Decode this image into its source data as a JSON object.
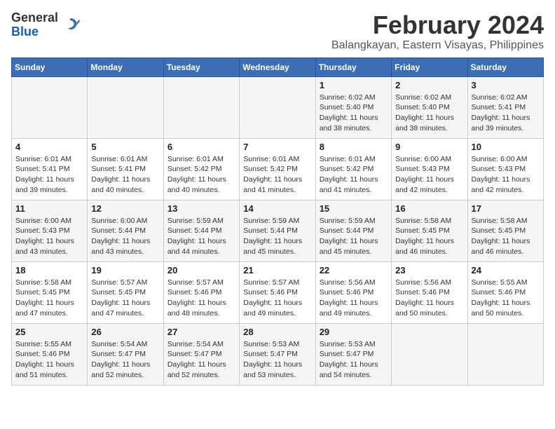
{
  "header": {
    "logo_general": "General",
    "logo_blue": "Blue",
    "month_title": "February 2024",
    "location": "Balangkayan, Eastern Visayas, Philippines"
  },
  "weekdays": [
    "Sunday",
    "Monday",
    "Tuesday",
    "Wednesday",
    "Thursday",
    "Friday",
    "Saturday"
  ],
  "weeks": [
    [
      {
        "day": "",
        "info": ""
      },
      {
        "day": "",
        "info": ""
      },
      {
        "day": "",
        "info": ""
      },
      {
        "day": "",
        "info": ""
      },
      {
        "day": "1",
        "info": "Sunrise: 6:02 AM\nSunset: 5:40 PM\nDaylight: 11 hours\nand 38 minutes."
      },
      {
        "day": "2",
        "info": "Sunrise: 6:02 AM\nSunset: 5:40 PM\nDaylight: 11 hours\nand 38 minutes."
      },
      {
        "day": "3",
        "info": "Sunrise: 6:02 AM\nSunset: 5:41 PM\nDaylight: 11 hours\nand 39 minutes."
      }
    ],
    [
      {
        "day": "4",
        "info": "Sunrise: 6:01 AM\nSunset: 5:41 PM\nDaylight: 11 hours\nand 39 minutes."
      },
      {
        "day": "5",
        "info": "Sunrise: 6:01 AM\nSunset: 5:41 PM\nDaylight: 11 hours\nand 40 minutes."
      },
      {
        "day": "6",
        "info": "Sunrise: 6:01 AM\nSunset: 5:42 PM\nDaylight: 11 hours\nand 40 minutes."
      },
      {
        "day": "7",
        "info": "Sunrise: 6:01 AM\nSunset: 5:42 PM\nDaylight: 11 hours\nand 41 minutes."
      },
      {
        "day": "8",
        "info": "Sunrise: 6:01 AM\nSunset: 5:42 PM\nDaylight: 11 hours\nand 41 minutes."
      },
      {
        "day": "9",
        "info": "Sunrise: 6:00 AM\nSunset: 5:43 PM\nDaylight: 11 hours\nand 42 minutes."
      },
      {
        "day": "10",
        "info": "Sunrise: 6:00 AM\nSunset: 5:43 PM\nDaylight: 11 hours\nand 42 minutes."
      }
    ],
    [
      {
        "day": "11",
        "info": "Sunrise: 6:00 AM\nSunset: 5:43 PM\nDaylight: 11 hours\nand 43 minutes."
      },
      {
        "day": "12",
        "info": "Sunrise: 6:00 AM\nSunset: 5:44 PM\nDaylight: 11 hours\nand 43 minutes."
      },
      {
        "day": "13",
        "info": "Sunrise: 5:59 AM\nSunset: 5:44 PM\nDaylight: 11 hours\nand 44 minutes."
      },
      {
        "day": "14",
        "info": "Sunrise: 5:59 AM\nSunset: 5:44 PM\nDaylight: 11 hours\nand 45 minutes."
      },
      {
        "day": "15",
        "info": "Sunrise: 5:59 AM\nSunset: 5:44 PM\nDaylight: 11 hours\nand 45 minutes."
      },
      {
        "day": "16",
        "info": "Sunrise: 5:58 AM\nSunset: 5:45 PM\nDaylight: 11 hours\nand 46 minutes."
      },
      {
        "day": "17",
        "info": "Sunrise: 5:58 AM\nSunset: 5:45 PM\nDaylight: 11 hours\nand 46 minutes."
      }
    ],
    [
      {
        "day": "18",
        "info": "Sunrise: 5:58 AM\nSunset: 5:45 PM\nDaylight: 11 hours\nand 47 minutes."
      },
      {
        "day": "19",
        "info": "Sunrise: 5:57 AM\nSunset: 5:45 PM\nDaylight: 11 hours\nand 47 minutes."
      },
      {
        "day": "20",
        "info": "Sunrise: 5:57 AM\nSunset: 5:46 PM\nDaylight: 11 hours\nand 48 minutes."
      },
      {
        "day": "21",
        "info": "Sunrise: 5:57 AM\nSunset: 5:46 PM\nDaylight: 11 hours\nand 49 minutes."
      },
      {
        "day": "22",
        "info": "Sunrise: 5:56 AM\nSunset: 5:46 PM\nDaylight: 11 hours\nand 49 minutes."
      },
      {
        "day": "23",
        "info": "Sunrise: 5:56 AM\nSunset: 5:46 PM\nDaylight: 11 hours\nand 50 minutes."
      },
      {
        "day": "24",
        "info": "Sunrise: 5:55 AM\nSunset: 5:46 PM\nDaylight: 11 hours\nand 50 minutes."
      }
    ],
    [
      {
        "day": "25",
        "info": "Sunrise: 5:55 AM\nSunset: 5:46 PM\nDaylight: 11 hours\nand 51 minutes."
      },
      {
        "day": "26",
        "info": "Sunrise: 5:54 AM\nSunset: 5:47 PM\nDaylight: 11 hours\nand 52 minutes."
      },
      {
        "day": "27",
        "info": "Sunrise: 5:54 AM\nSunset: 5:47 PM\nDaylight: 11 hours\nand 52 minutes."
      },
      {
        "day": "28",
        "info": "Sunrise: 5:53 AM\nSunset: 5:47 PM\nDaylight: 11 hours\nand 53 minutes."
      },
      {
        "day": "29",
        "info": "Sunrise: 5:53 AM\nSunset: 5:47 PM\nDaylight: 11 hours\nand 54 minutes."
      },
      {
        "day": "",
        "info": ""
      },
      {
        "day": "",
        "info": ""
      }
    ]
  ]
}
